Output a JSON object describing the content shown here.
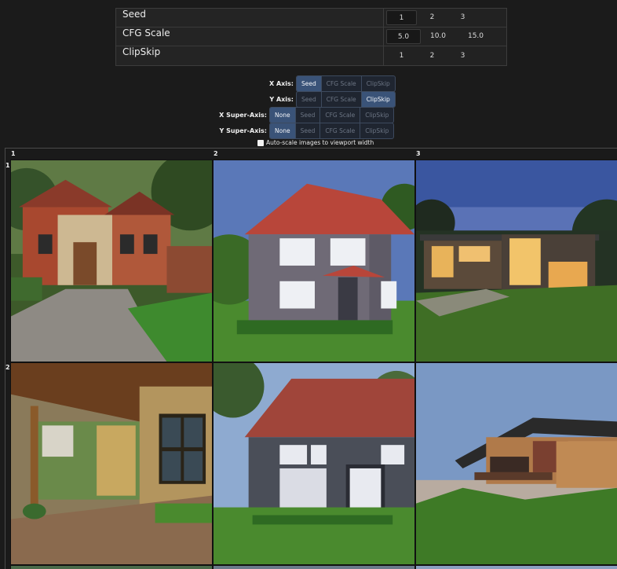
{
  "params": [
    {
      "name": "Seed",
      "values": [
        "1",
        "2",
        "3"
      ],
      "selected": 0
    },
    {
      "name": "CFG Scale",
      "values": [
        "5.0",
        "10.0",
        "15.0"
      ],
      "selected": 0
    },
    {
      "name": "ClipSkip",
      "values": [
        "1",
        "2",
        "3"
      ],
      "selected": -1
    }
  ],
  "axes": {
    "x_label": "X Axis:",
    "y_label": "Y Axis:",
    "xs_label": "X Super-Axis:",
    "ys_label": "Y Super-Axis:",
    "opt_none": "None",
    "opt_seed": "Seed",
    "opt_cfg": "CFG Scale",
    "opt_clip": "ClipSkip"
  },
  "autoscale_label": "Auto-scale images to viewport width",
  "grid": {
    "col_headers": [
      "1",
      "2",
      "3"
    ],
    "row_headers": [
      "1",
      "2"
    ]
  }
}
